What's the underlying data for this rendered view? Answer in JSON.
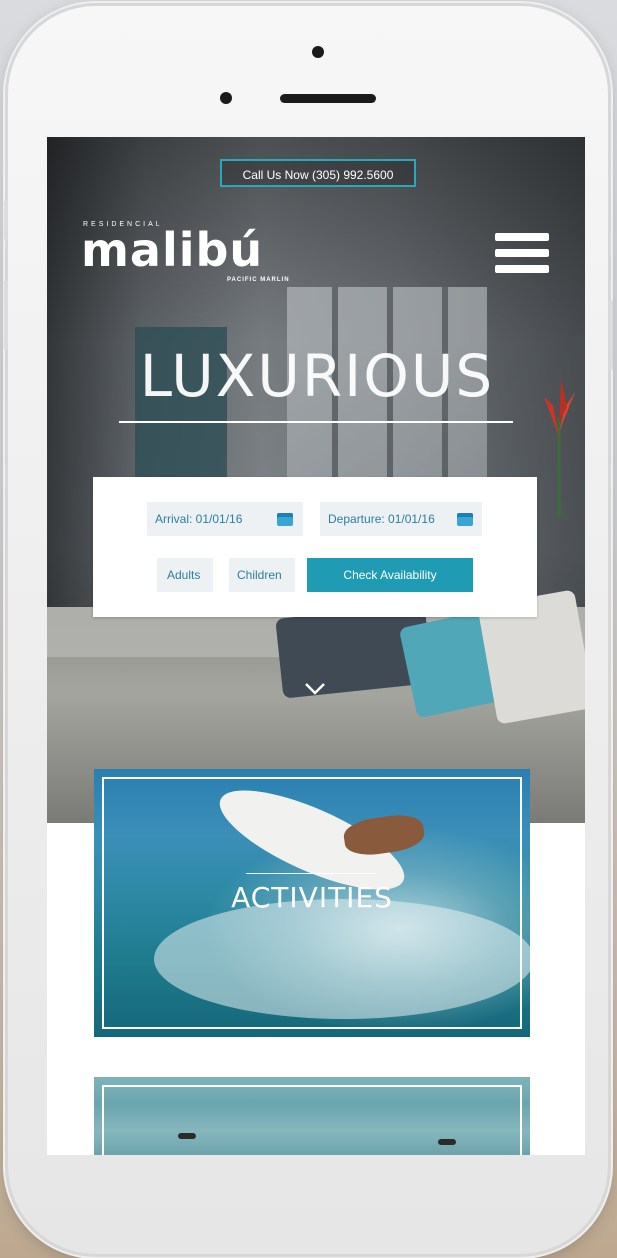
{
  "header": {
    "call_button_label": "Call Us Now (305) 992.5600",
    "logo": {
      "prefix": "RESIDENCIAL",
      "word": "malibú",
      "subtitle": "PACIFIC MARLIN"
    }
  },
  "hero": {
    "headline": "LUXURIOUS"
  },
  "booking": {
    "arrival_label": "Arrival: 01/01/16",
    "departure_label": "Departure: 01/01/16",
    "adults_label": "Adults",
    "children_label": "Children",
    "check_button_label": "Check Availability"
  },
  "sections": [
    {
      "title": "ACTIVITIES"
    }
  ],
  "colors": {
    "accent": "#1f9cb3",
    "field_text": "#2b7f9e",
    "field_bg": "#eef1f3"
  }
}
